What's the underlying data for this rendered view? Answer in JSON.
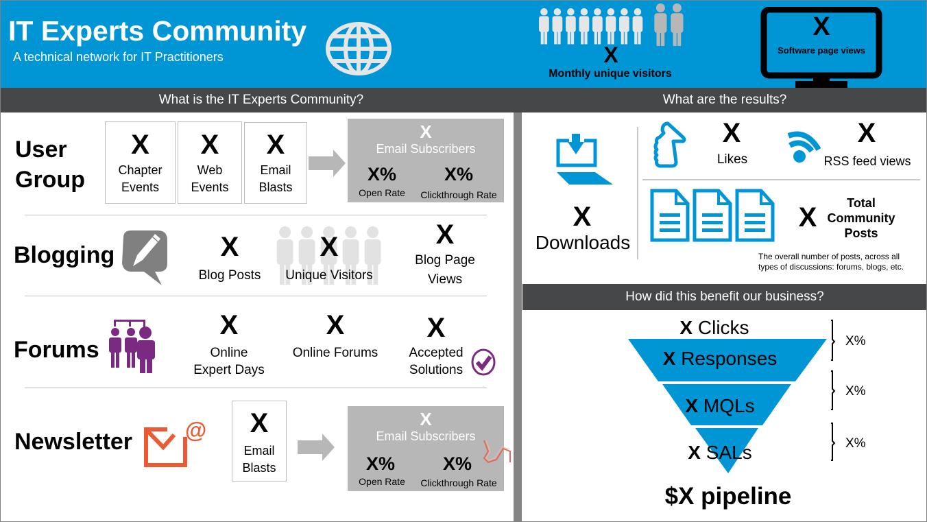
{
  "header": {
    "title": "IT Experts Community",
    "subtitle": "A technical network for IT Practitioners",
    "visitors": {
      "value": "X",
      "label": "Monthly unique visitors"
    },
    "software_views": {
      "value": "X",
      "label": "Software page views"
    }
  },
  "colors": {
    "brand_blue": "#0096d6",
    "bar_dark": "#464749",
    "card_gray": "#b7b7b7",
    "forums_purple": "#7b2a82",
    "newsletter_orange": "#ea5a33",
    "icon_gray": "#808080"
  },
  "left": {
    "heading": "What is the IT Experts Community?",
    "user_group": {
      "title_line1": "User",
      "title_line2": "Group",
      "boxes": [
        {
          "value": "X",
          "line1": "Chapter",
          "line2": "Events"
        },
        {
          "value": "X",
          "line1": "Web",
          "line2": "Events"
        },
        {
          "value": "X",
          "line1": "Email",
          "line2": "Blasts"
        }
      ],
      "card": {
        "value": "X",
        "label": "Email Subscribers",
        "open_rate": "X%",
        "open_rate_label": "Open Rate",
        "ctr": "X%",
        "ctr_label": "Clickthrough Rate"
      }
    },
    "blogging": {
      "title": "Blogging",
      "stats": [
        {
          "value": "X",
          "label": "Blog Posts"
        },
        {
          "value": "X",
          "label": "Unique Visitors"
        },
        {
          "value": "X",
          "line1": "Blog Page",
          "line2": "Views"
        }
      ]
    },
    "forums": {
      "title": "Forums",
      "stats": [
        {
          "value": "X",
          "line1": "Online",
          "line2": "Expert Days"
        },
        {
          "value": "X",
          "label": "Online Forums"
        },
        {
          "value": "X",
          "line1": "Accepted",
          "line2": "Solutions"
        }
      ]
    },
    "newsletter": {
      "title": "Newsletter",
      "box": {
        "value": "X",
        "line1": "Email",
        "line2": "Blasts"
      },
      "card": {
        "value": "X",
        "label": "Email Subscribers",
        "open_rate": "X%",
        "open_rate_label": "Open Rate",
        "ctr": "X%",
        "ctr_label": "Clickthrough Rate"
      }
    }
  },
  "right": {
    "heading": "What are the results?",
    "downloads": {
      "value": "X",
      "label": "Downloads"
    },
    "likes": {
      "value": "X",
      "label": "Likes"
    },
    "rss": {
      "value": "X",
      "label": "RSS feed views"
    },
    "posts": {
      "value": "X",
      "label_line1": "Total",
      "label_line2": "Community",
      "label_line3": "Posts",
      "note_line1": "The overall number of posts, across all",
      "note_line2": "types of discussions: forums, blogs, etc."
    },
    "business": {
      "heading": "How did this benefit our business?",
      "funnel": [
        {
          "value": "X",
          "label": "Clicks"
        },
        {
          "value": "X",
          "label": "Responses"
        },
        {
          "value": "X",
          "label": "MQLs"
        },
        {
          "value": "X",
          "label": "SALs"
        }
      ],
      "conversions": [
        "X%",
        "X%",
        "X%"
      ],
      "pipeline": "$X pipeline"
    }
  }
}
